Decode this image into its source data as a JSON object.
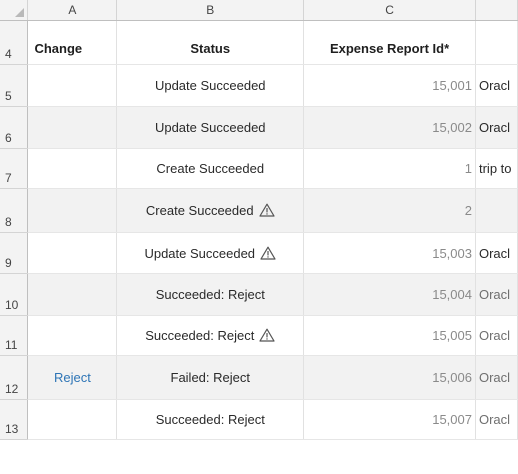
{
  "columns": {
    "a": "A",
    "b": "B",
    "c": "C"
  },
  "header_row": {
    "number": "4",
    "change": "Change",
    "status": "Status",
    "expense_report_id": "Expense Report Id*"
  },
  "rows": [
    {
      "number": "5",
      "change": "",
      "status": "Update Succeeded",
      "warning": false,
      "id": "15,001",
      "desc": "Oracl",
      "desc_dim": false
    },
    {
      "number": "6",
      "change": "",
      "status": "Update Succeeded",
      "warning": false,
      "id": "15,002",
      "desc": "Oracl",
      "desc_dim": false
    },
    {
      "number": "7",
      "change": "",
      "status": "Create Succeeded",
      "warning": false,
      "id": "1",
      "desc": "trip to",
      "desc_dim": false
    },
    {
      "number": "8",
      "change": "",
      "status": "Create Succeeded",
      "warning": true,
      "id": "2",
      "desc": "",
      "desc_dim": false
    },
    {
      "number": "9",
      "change": "",
      "status": "Update Succeeded",
      "warning": true,
      "id": "15,003",
      "desc": "Oracl",
      "desc_dim": false
    },
    {
      "number": "10",
      "change": "",
      "status": "Succeeded: Reject",
      "warning": false,
      "id": "15,004",
      "desc": "Oracl",
      "desc_dim": true
    },
    {
      "number": "11",
      "change": "",
      "status": "Succeeded: Reject",
      "warning": true,
      "id": "15,005",
      "desc": "Oracl",
      "desc_dim": true
    },
    {
      "number": "12",
      "change": "Reject",
      "status": "Failed: Reject",
      "warning": false,
      "id": "15,006",
      "desc": "Oracl",
      "desc_dim": true
    },
    {
      "number": "13",
      "change": "",
      "status": "Succeeded: Reject",
      "warning": false,
      "id": "15,007",
      "desc": "Oracl",
      "desc_dim": true
    }
  ],
  "icons": {
    "corner": "select-all-triangle-icon",
    "warning": "warning-triangle-icon"
  },
  "colors": {
    "link": "#2e75b6",
    "grey_cell": "#f2f2f2"
  }
}
